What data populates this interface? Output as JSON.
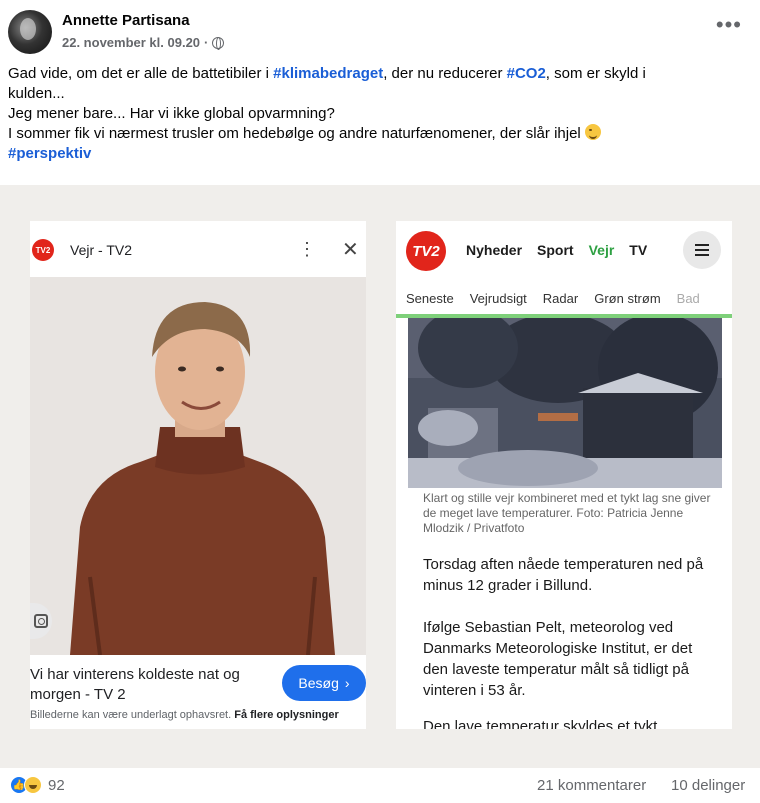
{
  "post": {
    "author": "Annette Partisana",
    "timestamp": "22. november kl. 09.20",
    "privacy_icon": "globe-icon",
    "more_label": "•••",
    "text": {
      "l1_a": "Gad vide, om det er alle de battetibiler i ",
      "l1_tag1": "#klimabedraget",
      "l1_b": ", der nu reducerer ",
      "l1_tag2": "#CO2",
      "l1_c": ", som er skyld i",
      "l2": "kulden...",
      "l3": "Jeg mener bare... Har vi ikke global opvarmning?",
      "l4": "I sommer fik vi nærmest trusler om hedebølge og andre naturfænomener, der slår ihjel ",
      "l5_tag": "#perspektiv"
    }
  },
  "left_card": {
    "badge": "TV2",
    "title": "Vejr - TV2",
    "caption": "Vi har vinterens koldeste nat og morgen - TV 2",
    "visit_label": "Besøg",
    "disclaimer_a": "Billederne kan være underlagt ophavsret. ",
    "disclaimer_b": "Få flere oplysninger"
  },
  "right_card": {
    "logo": "TV2",
    "nav": [
      "Nyheder",
      "Sport",
      "Vejr",
      "TV"
    ],
    "subnav": [
      "Seneste",
      "Vejrudsigt",
      "Radar",
      "Grøn strøm",
      "Bad"
    ],
    "photo_caption": "Klart og stille vejr kombineret med et tykt lag sne giver de meget lave temperaturer. Foto: Patricia Jenne Mlodzik / Privatfoto",
    "para1": "Torsdag aften nåede temperaturen ned på minus 12 grader i Billund.",
    "para2": "Ifølge Sebastian Pelt, meteorolog ved Danmarks Meteorologiske Institut, er det den laveste temperatur målt så tidligt på vinteren i 53 år.",
    "para3": "Den lave temperatur skyldes et tykt"
  },
  "footer": {
    "reaction_count": "92",
    "comments": "21 kommentarer",
    "shares": "10 delinger"
  },
  "colors": {
    "hashtag": "#1a5ed6",
    "tv2_red": "#e1251b",
    "visit_blue": "#1f6feb",
    "vejr_green": "#2ea043"
  }
}
